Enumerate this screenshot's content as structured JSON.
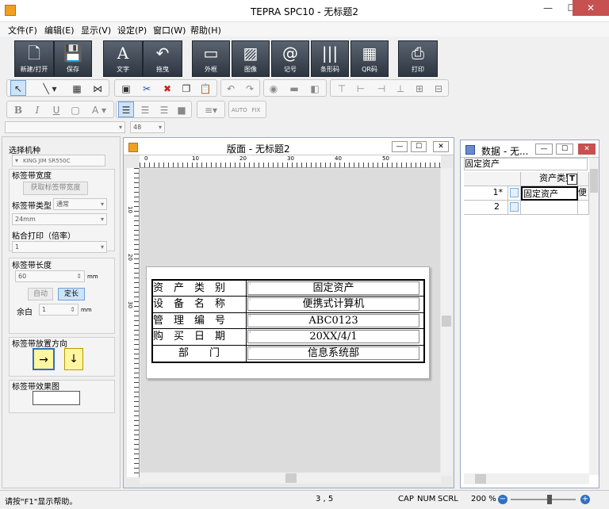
{
  "window": {
    "title": "TEPRA SPC10 - 无标题2",
    "minimize": "—",
    "maximize": "☐",
    "close": "✕"
  },
  "menu": {
    "items": [
      "文件(F)",
      "编辑(E)",
      "显示(V)",
      "设定(P)",
      "窗口(W)",
      "帮助(H)"
    ]
  },
  "bigtoolbar": {
    "new_open": "新建/打开",
    "save": "保存",
    "text": "文字",
    "drag": "拖曳",
    "frame": "外框",
    "image": "图像",
    "symbol": "记号",
    "barcode": "条形码",
    "qrcode": "QR码",
    "print": "打印"
  },
  "fontbar": {
    "font_name": "",
    "font_size": "48"
  },
  "left_panel": {
    "model_label": "选择机种",
    "model_value": "KING JIM SR550C",
    "tape_width_label": "标签带宽度",
    "get_width_button": "获取标签带宽度",
    "tape_type_label": "标签带类型",
    "tape_type_value": "通常",
    "tape_width_value": "24mm",
    "paste_print_label": "粘合打印（倍率）",
    "paste_print_value": "1",
    "tape_length_label": "标签带长度",
    "tape_length_value": "60",
    "tape_length_unit": "mm",
    "auto_button": "自动",
    "fixed_button": "定长",
    "margin_label": "余白",
    "margin_value": "1",
    "margin_unit": "mm",
    "direction_label": "标签带放置方向",
    "horizontal_arrow": "→",
    "vertical_arrow": "↓",
    "preview_label": "标签带效果图"
  },
  "layout_window": {
    "title": "版面 - 无标题2",
    "ruler_h": [
      "0",
      "10",
      "20",
      "30",
      "40",
      "50"
    ],
    "ruler_v": [
      "10",
      "20",
      "30"
    ]
  },
  "label": {
    "rows": [
      {
        "key": "资　产　类　别",
        "value": "固定资产"
      },
      {
        "key": "设　备　名　称",
        "value": "便携式计算机"
      },
      {
        "key": "管　理　编　号",
        "value": "ABC0123"
      },
      {
        "key": "购　买　日　期",
        "value": "20XX/4/1"
      },
      {
        "key": "部　　门",
        "value": "信息系统部"
      }
    ]
  },
  "data_window": {
    "title": "数据 - 无...",
    "formula_value": "固定资产",
    "column_header": "资产类别",
    "col2_header_partial": "",
    "rows": [
      {
        "num": "1*",
        "value": "固定资产",
        "value2": "便"
      },
      {
        "num": "2",
        "value": "",
        "value2": ""
      }
    ]
  },
  "statusbar": {
    "help": "请按\"F1\"显示帮助。",
    "position": "3 , 5",
    "cap": "CAP",
    "num": "NUM",
    "scrl": "SCRL",
    "zoom": "200 %"
  },
  "colors": {
    "bigtoolbar_bg": "#2d3540",
    "selected_button": "#cde3f7",
    "close_button": "#c75050",
    "direction_button": "#fff6a0"
  }
}
